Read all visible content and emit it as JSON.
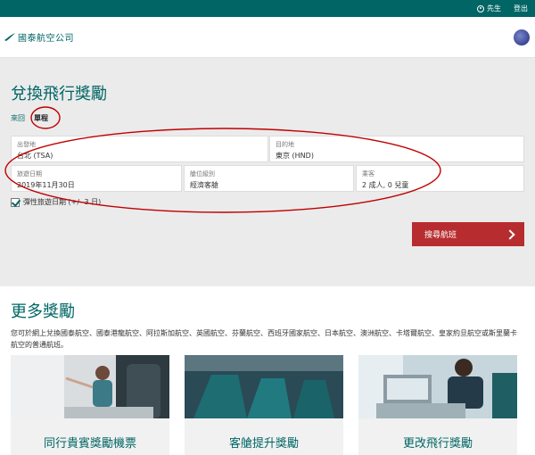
{
  "topbar": {
    "user_name": "先生",
    "logout_label": "登出",
    "user_icon": "user-icon"
  },
  "header": {
    "logo_text": "國泰航空公司",
    "logo_icon": "brushwing-logo-icon",
    "alliance_icon": "oneworld-logo-icon"
  },
  "booking": {
    "title": "兌換飛行獎勵",
    "tabs": [
      {
        "label": "來回"
      },
      {
        "label": "單程"
      }
    ],
    "fields": {
      "from": {
        "label": "出發地",
        "value": "台北 (TSA)"
      },
      "to": {
        "label": "目的地",
        "value": "東京 (HND)"
      },
      "date": {
        "label": "旅遊日期",
        "value": "2019年11月30日"
      },
      "cabin": {
        "label": "艙位級別",
        "value": "經濟客艙"
      },
      "passengers": {
        "label": "乘客",
        "value": "2 成人, 0 兒童"
      }
    },
    "flexible_label": "彈性旅遊日期 (+/- 3 日)",
    "search_label": "搜尋航班"
  },
  "more": {
    "title": "更多獎勵",
    "description": "您可於網上兌換國泰航空、國泰港龍航空、阿拉斯加航空、英國航空、芬蘭航空、西班牙國家航空、日本航空、澳洲航空、卡塔爾航空、皇家約旦航空或斯里蘭卡航空的普通航班。",
    "cards": [
      {
        "title": "同行貴賓獎勵機票"
      },
      {
        "title": "客艙提升獎勵"
      },
      {
        "title": "更改飛行獎勵"
      }
    ]
  },
  "colors": {
    "brand": "#006564",
    "accent_red": "#b72d2f",
    "annotation": "#c00000"
  }
}
